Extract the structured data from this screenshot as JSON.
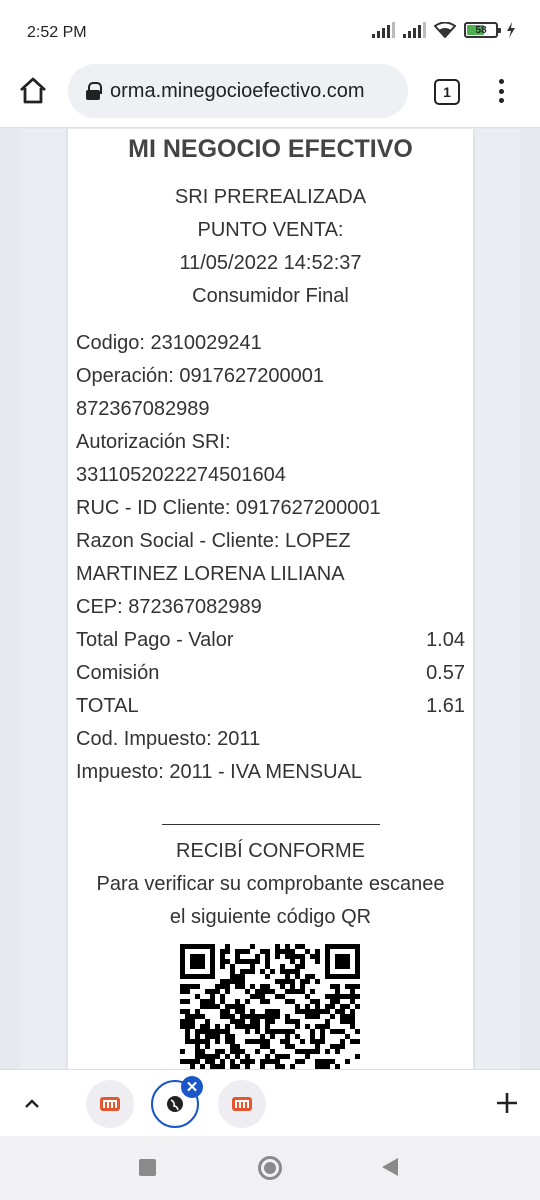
{
  "status_bar": {
    "time": "2:52 PM",
    "battery": "58"
  },
  "browser": {
    "url": "orma.minegocioefectivo.com",
    "tab_count": "1"
  },
  "receipt": {
    "title": "MI NEGOCIO EFECTIVO",
    "header_lines": [
      "SRI PREREALIZADA",
      "PUNTO VENTA:",
      "11/05/2022 14:52:37",
      "Consumidor Final"
    ],
    "codigo": "Codigo: 2310029241",
    "operacion_1": "Operación: 0917627200001",
    "operacion_2": "872367082989",
    "autorizacion_1": "Autorización SRI:",
    "autorizacion_2": "3311052022274501604",
    "ruc": "RUC - ID Cliente: 0917627200001",
    "razon_1": "Razon Social - Cliente: LOPEZ",
    "razon_2": "MARTINEZ LORENA LILIANA",
    "cep": "CEP: 872367082989",
    "amounts": [
      {
        "label": "Total Pago - Valor",
        "value": "1.04"
      },
      {
        "label": "Comisión",
        "value": "0.57"
      },
      {
        "label": "TOTAL",
        "value": "1.61"
      }
    ],
    "cod_impuesto": "Cod. Impuesto: 2011",
    "impuesto": "Impuesto: 2011 - IVA MENSUAL",
    "conforme": "RECIBÍ CONFORME",
    "verify_1": "Para verificar su comprobante escanee",
    "verify_2": "el siguiente código QR"
  },
  "tab_strip": {
    "close_symbol": "✕"
  },
  "colors": {
    "accent": "#1a56c8",
    "favicon": "#e4572e"
  }
}
